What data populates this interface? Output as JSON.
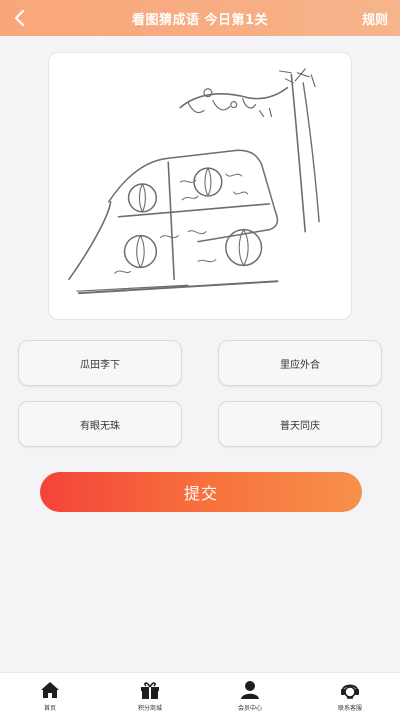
{
  "header": {
    "title": "看图猜成语 今日第1关",
    "rules_label": "规则",
    "back_icon": "chevron-left-icon"
  },
  "puzzle": {
    "image_description_icon": "puzzle-illustration"
  },
  "options": [
    {
      "label": "瓜田李下"
    },
    {
      "label": "里应外合"
    },
    {
      "label": "有眼无珠"
    },
    {
      "label": "普天同庆"
    }
  ],
  "submit": {
    "label": "提交"
  },
  "tabbar": {
    "items": [
      {
        "label": "首页",
        "icon": "home-icon"
      },
      {
        "label": "积分商城",
        "icon": "gift-icon"
      },
      {
        "label": "会员中心",
        "icon": "user-icon"
      },
      {
        "label": "联系客服",
        "icon": "customer-service-icon"
      }
    ]
  },
  "colors": {
    "header": "#f9a77a",
    "submit_start": "#f4433a",
    "submit_end": "#f7904a"
  }
}
